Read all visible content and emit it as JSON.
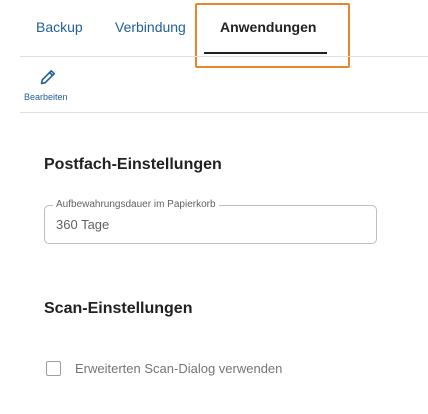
{
  "tabs": {
    "backup": "Backup",
    "verbindung": "Verbindung",
    "anwendungen": "Anwendungen",
    "active": "Anwendungen"
  },
  "toolbar": {
    "edit_label": "Bearbeiten",
    "edit_icon": "pencil-icon"
  },
  "postfach": {
    "title": "Postfach-Einstellungen",
    "retention_label": "Aufbewahrungsdauer im Papierkorb",
    "retention_value": "360 Tage"
  },
  "scan": {
    "title": "Scan-Einstellungen",
    "extended_dialog_label": "Erweiterten Scan-Dialog verwenden",
    "extended_dialog_checked": false
  },
  "colors": {
    "accent": "#1f5f9c",
    "highlight": "#e8862a",
    "text": "#212121",
    "muted": "#757575"
  }
}
